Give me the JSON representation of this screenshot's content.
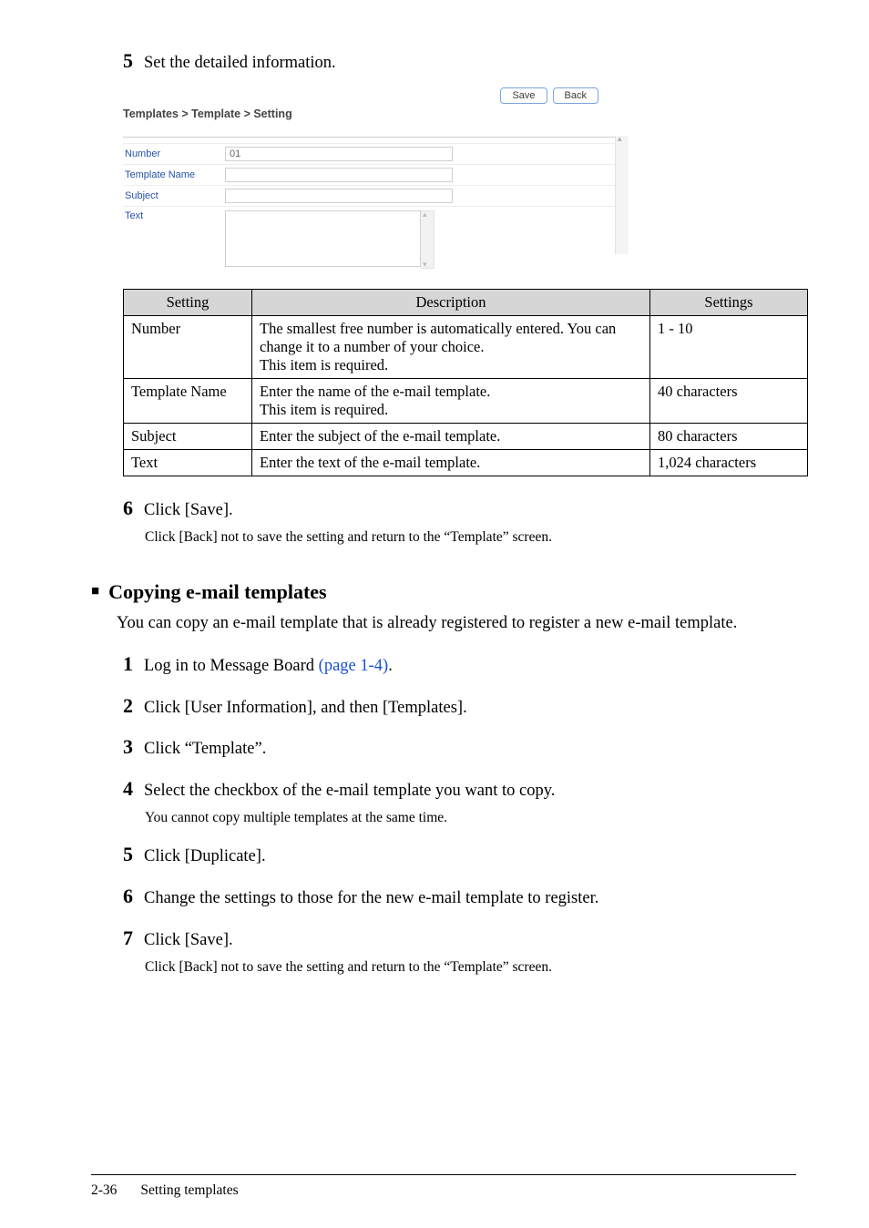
{
  "step5": {
    "num": "5",
    "text": "Set the detailed information."
  },
  "screenshot": {
    "save": "Save",
    "back": "Back",
    "breadcrumb": "Templates > Template > Setting",
    "rows": {
      "number_label": "Number",
      "number_value": "01",
      "template_label": "Template Name",
      "subject_label": "Subject",
      "text_label": "Text"
    }
  },
  "table": {
    "head": {
      "c1": "Setting",
      "c2": "Description",
      "c3": "Settings"
    },
    "rows": [
      {
        "c1": "Number",
        "c2": "The smallest free number is automatically entered.  You can change it to a number of your choice.\nThis item is required.",
        "c3": "1 - 10"
      },
      {
        "c1": "Template Name",
        "c2": "Enter the name of the e-mail template.\nThis item is required.",
        "c3": "40 characters"
      },
      {
        "c1": "Subject",
        "c2": "Enter the subject of the e-mail template.",
        "c3": "80 characters"
      },
      {
        "c1": "Text",
        "c2": "Enter the text of the e-mail template.",
        "c3": "1,024 characters"
      }
    ]
  },
  "step6": {
    "num": "6",
    "text": "Click [Save].",
    "sub": "Click [Back] not to save the setting and return to the “Template” screen."
  },
  "section": {
    "bullet": "■",
    "title": "Copying e-mail templates",
    "intro": "You can copy an e-mail template that is already registered to register a new e-mail template."
  },
  "copy_steps": [
    {
      "num": "1",
      "text_pre": "Log in to Message Board ",
      "link": "(page 1-4)",
      "text_post": "."
    },
    {
      "num": "2",
      "text": "Click [User Information], and then [Templates]."
    },
    {
      "num": "3",
      "text": "Click “Template”."
    },
    {
      "num": "4",
      "text": "Select the checkbox of the e-mail template you want to copy.",
      "sub": "You cannot copy multiple templates at the same time."
    },
    {
      "num": "5",
      "text": "Click [Duplicate]."
    },
    {
      "num": "6",
      "text": "Change the settings to those for the new e-mail template to register."
    },
    {
      "num": "7",
      "text": "Click [Save].",
      "sub": "Click [Back] not to save the setting and return to the “Template” screen."
    }
  ],
  "footer": {
    "page": "2-36",
    "title": "Setting templates"
  }
}
